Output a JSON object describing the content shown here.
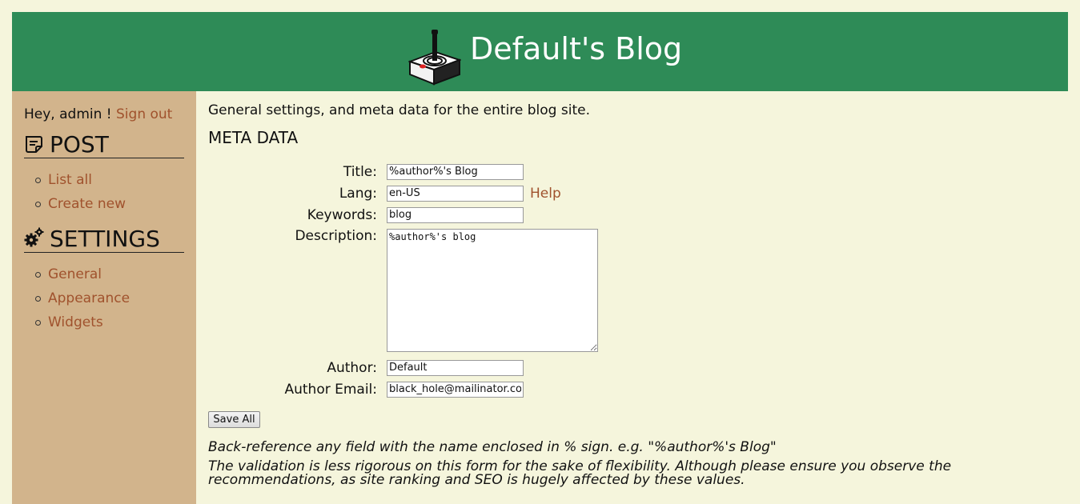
{
  "header": {
    "site_title": "Default's Blog",
    "logo_icon": "joystick-icon"
  },
  "sidebar": {
    "greeting": "Hey, admin !",
    "sign_out": "Sign out",
    "sections": [
      {
        "icon": "post-icon",
        "title": "POST",
        "items": [
          {
            "label": "List all"
          },
          {
            "label": "Create new"
          }
        ]
      },
      {
        "icon": "gears-icon",
        "title": "SETTINGS",
        "items": [
          {
            "label": "General"
          },
          {
            "label": "Appearance"
          },
          {
            "label": "Widgets"
          }
        ]
      }
    ]
  },
  "main": {
    "intro": "General settings, and meta data for the entire blog site.",
    "section_heading": "META DATA",
    "form": {
      "title_label": "Title:",
      "title_value": "%author%'s Blog",
      "lang_label": "Lang:",
      "lang_value": "en-US",
      "help_link": "Help",
      "keywords_label": "Keywords:",
      "keywords_value": "blog",
      "description_label": "Description:",
      "description_value": "%author%'s blog",
      "author_label": "Author:",
      "author_value": "Default",
      "author_email_label": "Author Email:",
      "author_email_value": "black_hole@mailinator.com",
      "save_label": "Save All"
    },
    "notes": [
      "Back-reference any field with the name enclosed in % sign. e.g. \"%author%'s Blog\"",
      "The validation is less rigorous on this form for the sake of flexibility. Although please ensure you observe the recommendations, as site ranking and SEO is hugely affected by these values."
    ]
  },
  "colors": {
    "background": "#f5f5dc",
    "header": "#2e8b57",
    "sidebar": "#d2b48c",
    "link": "#a0522d"
  }
}
